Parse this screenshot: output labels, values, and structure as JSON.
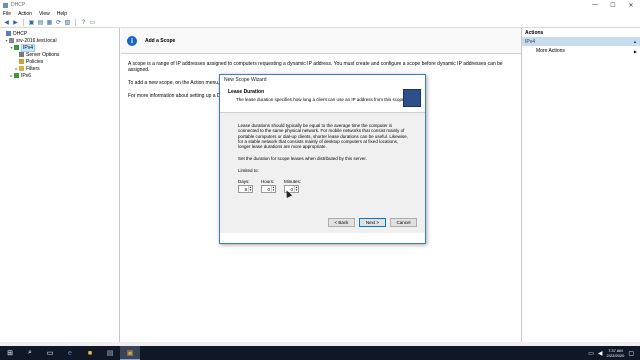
{
  "window": {
    "title": "DHCP",
    "controls": [
      "—",
      "☐",
      "✕"
    ]
  },
  "menu": [
    "File",
    "Action",
    "View",
    "Help"
  ],
  "toolbar": {
    "buttons": [
      "back-arrow-icon",
      "forward-arrow-icon",
      "up-folder-icon",
      "show-hide-tree-icon",
      "properties-icon",
      "refresh-icon",
      "export-list-icon",
      "help-icon",
      "console-icon"
    ]
  },
  "tree": {
    "root": "DHCP",
    "server": "srv-2016.test.local",
    "ipv4": "IPv4",
    "server_options": "Server Options",
    "policies": "Policies",
    "filters": "Filters",
    "ipv6": "IPv6"
  },
  "content": {
    "banner_title": "Add a Scope",
    "p1": "A scope is a range of IP addresses assigned to computers requesting a dynamic IP address. You must create and configure a scope before dynamic IP addresses can be assigned.",
    "p2": "To add a new scope, on the Action menu, click New Scope.",
    "p3": "For more information about setting up a D"
  },
  "actions": {
    "header": "Actions",
    "group": "IPv4",
    "more": "More Actions"
  },
  "dialog": {
    "title": "New Scope Wizard",
    "header_title": "Lease Duration",
    "header_subtitle": "The lease duration specifies how long a client can use an IP address from this scope.",
    "para1": "Lease durations should typically be equal to the average time the computer is connected to the same physical network. For mobile networks that consist mainly of portable computers or dial-up clients, shorter lease durations can be useful. Likewise, for a stable network that consists mainly of desktop computers at fixed locations, longer lease durations are more appropriate.",
    "para2": "Set the duration for scope leases when distributed by this server.",
    "limited_to": "Limited to:",
    "days_label": "Days:",
    "days_value": "8",
    "hours_label": "Hours:",
    "hours_value": "0",
    "minutes_label": "Minutes:",
    "minutes_value": "0",
    "back": "< Back",
    "next": "Next >",
    "cancel": "Cancel"
  },
  "taskbar": {
    "time": "7:37 AM",
    "date": "2/22/2020"
  }
}
